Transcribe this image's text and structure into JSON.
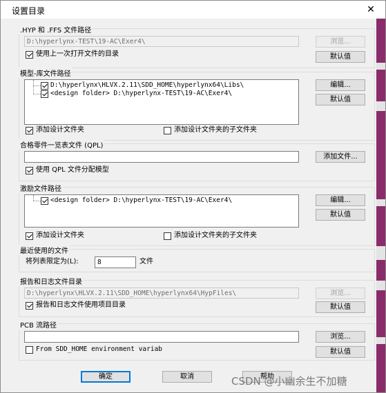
{
  "window": {
    "title": "设置目录",
    "close_glyph": "✕"
  },
  "hyp_group": {
    "label": ".HYP 和 .FFS 文件路径",
    "path": "D:\\hyperlynx-TEST\\19-AC\\Exer4\\",
    "browse": "浏览...",
    "default": "默认值",
    "use_last_label": "使用上一次打开文件的目录"
  },
  "model_group": {
    "label": "模型-库文件路径",
    "items": [
      "D:\\hyperlynx\\HLVX.2.11\\SDD_HOME\\hyperlynx64\\Libs\\",
      "<design folder>  D:\\hyperlynx-TEST\\19-AC\\Exer4\\"
    ],
    "edit": "编辑...",
    "default": "默认值",
    "add_design_label": "添加设计文件夹",
    "add_subfolder_label": "添加设计文件夹的子文件夹"
  },
  "qpl_group": {
    "label": "合格零件一览表文件 (QPL)",
    "path": "",
    "add_file": "添加文件...",
    "use_qpl_label": "使用 QPL 文件分配模型"
  },
  "stim_group": {
    "label": "激励文件路径",
    "items": [
      "<design folder>  D:\\hyperlynx-TEST\\19-AC\\Exer4\\"
    ],
    "edit": "编辑...",
    "default": "默认值",
    "add_design_label": "添加设计文件夹",
    "add_subfolder_label": "添加设计文件夹的子文件夹"
  },
  "recent_group": {
    "label": "最近使用的文件",
    "limit_label": "将列表限定为(L):",
    "limit_value": "8",
    "unit": "文件"
  },
  "report_group": {
    "label": "报告和日志文件目录",
    "path": "D:\\hyperlynx\\HLVX.2.11\\SDD_HOME\\hyperlynx64\\HypFiles\\",
    "browse": "浏览...",
    "default": "默认值",
    "use_project_label": "报告和日志文件使用项目目录"
  },
  "pcb_group": {
    "label": "PCB 流路径",
    "path": "",
    "browse": "浏览...",
    "default": "默认值",
    "sdd_label": "From SDD_HOME environment variab"
  },
  "footer": {
    "ok": "确定",
    "cancel": "取消",
    "help": "帮助"
  },
  "watermark": "CSDN @小幽余生不加糖"
}
